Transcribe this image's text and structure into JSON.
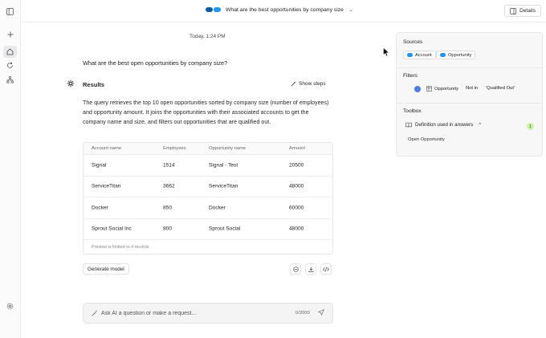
{
  "topbar": {
    "title": "What are the best opportunities by company size",
    "details_label": "Details"
  },
  "conversation": {
    "timestamp": "Today, 1:24 PM",
    "question": "What are the best open opportunities by company size?",
    "results_title": "Results",
    "show_steps_label": "Show steps",
    "description": "The query retrieves the top 10 open opportunities sorted by company size (number of employees) and opportunity amount. It joins the opportunities with their associated accounts to get the company name and size, and filters out opportunities that are qualified out."
  },
  "table": {
    "headers": [
      "Account name",
      "Employees",
      "Opportunity name",
      "Amount"
    ],
    "rows": [
      [
        "Signal",
        "1514",
        "Signal - Test",
        "20500"
      ],
      [
        "ServiceTitan",
        "3662",
        "ServiceTitan",
        "48000"
      ],
      [
        "Docker",
        "850",
        "Docker",
        "60000"
      ],
      [
        "Sprout Social Inc",
        "800",
        "Sprout Social",
        "48000"
      ]
    ],
    "note": "Preview is limited to 4 records"
  },
  "actions": {
    "generate_model_label": "Generate model"
  },
  "chat": {
    "placeholder": "Ask AI a question or make a request...",
    "counter": "0/2000"
  },
  "sidepanel": {
    "sources_title": "Sources",
    "sources": [
      "Account",
      "Opportunity"
    ],
    "filters_title": "Filters",
    "filter": {
      "object": "Opportunity",
      "operator": "Not in",
      "value": "'Qualified Out'"
    },
    "toolbox_title": "Toolbox",
    "definition_label": "Definition used in answers",
    "definition_count": "1",
    "definition_item": "Open Opportunity"
  },
  "colors": {
    "salesforce_blue": "#1b96ff",
    "filter_dot": "#4f7ce8",
    "badge_green": "#c9f1a6"
  }
}
